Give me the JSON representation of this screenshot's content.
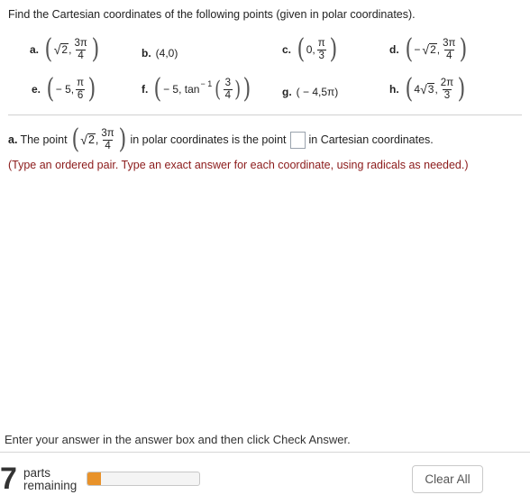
{
  "question": "Find the Cartesian coordinates of the following points (given in polar coordinates).",
  "points": {
    "a": {
      "label": "a.",
      "r": "2",
      "theta_num": "3π",
      "theta_den": "4"
    },
    "b": {
      "label": "b.",
      "text": "(4,0)"
    },
    "c": {
      "label": "c.",
      "r": "0,",
      "theta_num": "π",
      "theta_den": "3"
    },
    "d": {
      "label": "d.",
      "neg": "−",
      "r": "2",
      "theta_num": "3π",
      "theta_den": "4"
    },
    "e": {
      "label": "e.",
      "r": "− 5,",
      "theta_num": "π",
      "theta_den": "6"
    },
    "f": {
      "label": "f.",
      "r": "− 5, tan",
      "sup": "− 1",
      "theta_num": "3",
      "theta_den": "4"
    },
    "g": {
      "label": "g.",
      "text": "( − 4,5π)"
    },
    "h": {
      "label": "h.",
      "coef": "4",
      "r": "3",
      "theta_num": "2π",
      "theta_den": "3"
    }
  },
  "part_a": {
    "label": "a.",
    "prefix": "The point",
    "r": "2",
    "theta_num": "3π",
    "theta_den": "4",
    "middle": "in polar coordinates is the point",
    "suffix": "in Cartesian coordinates.",
    "answer_value": "",
    "hint": "(Type an ordered pair. Type an exact answer for each coordinate, using radicals as needed.)"
  },
  "footer": {
    "instruction": "Enter your answer in the answer box and then click Check Answer.",
    "parts_count": "7",
    "parts_label_1": "parts",
    "parts_label_2": "remaining",
    "progress_fraction": 0.12,
    "clear_label": "Clear All",
    "accent_color": "#e8922a"
  }
}
